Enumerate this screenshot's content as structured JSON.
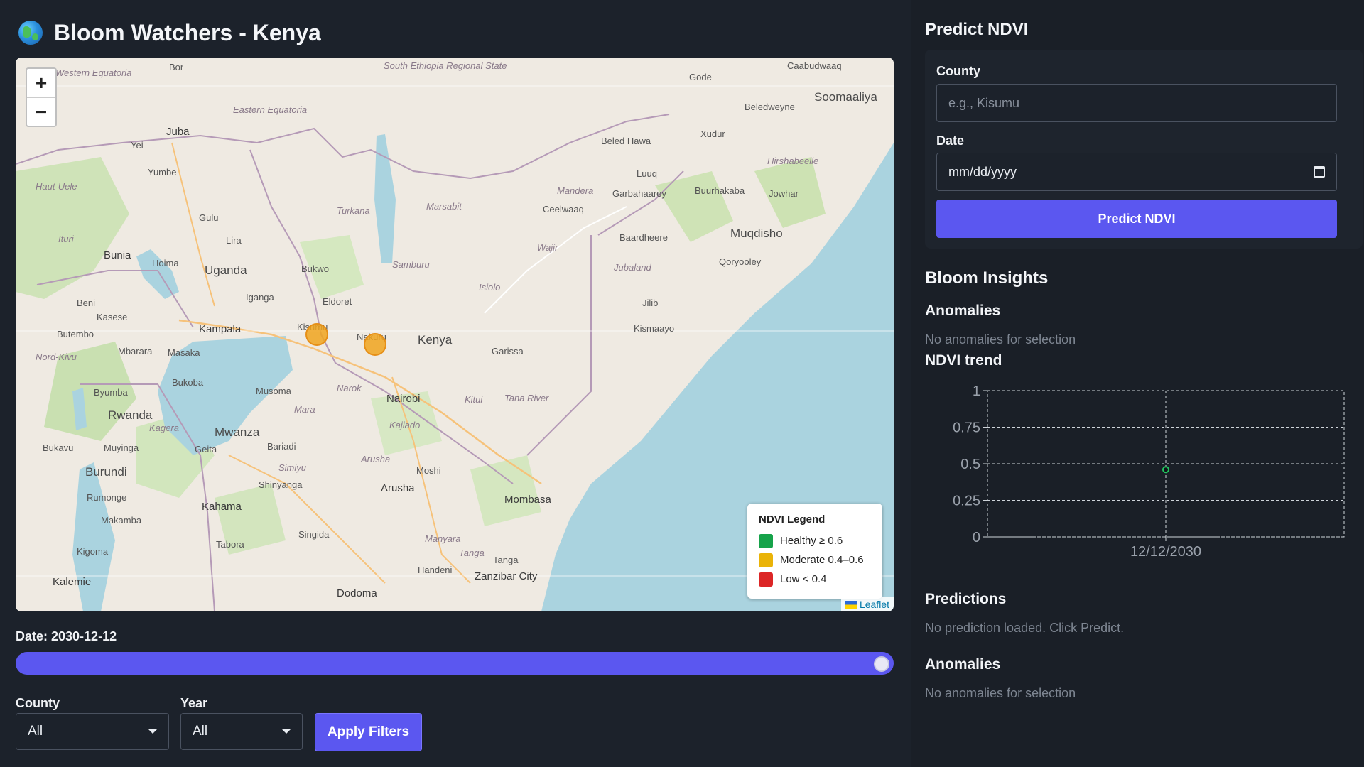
{
  "app": {
    "title": "Bloom Watchers - Kenya"
  },
  "map": {
    "labels": [
      {
        "text": "Bor"
      },
      {
        "text": "Juba"
      },
      {
        "text": "Yei"
      },
      {
        "text": "Yumbe"
      },
      {
        "text": "Gulu"
      },
      {
        "text": "Lira"
      },
      {
        "text": "Bunia"
      },
      {
        "text": "Hoima"
      },
      {
        "text": "Uganda"
      },
      {
        "text": "Beni"
      },
      {
        "text": "Kasese"
      },
      {
        "text": "Kampala"
      },
      {
        "text": "Butembo"
      },
      {
        "text": "Mbarara"
      },
      {
        "text": "Masaka"
      },
      {
        "text": "Bukoba"
      },
      {
        "text": "Byumba"
      },
      {
        "text": "Rwanda"
      },
      {
        "text": "Bukavu"
      },
      {
        "text": "Muyinga"
      },
      {
        "text": "Burundi"
      },
      {
        "text": "Rumonge"
      },
      {
        "text": "Makamba"
      },
      {
        "text": "Kigoma"
      },
      {
        "text": "Kalemie"
      },
      {
        "text": "Mwanza"
      },
      {
        "text": "Geita"
      },
      {
        "text": "Musoma"
      },
      {
        "text": "Bariadi"
      },
      {
        "text": "Shinyanga"
      },
      {
        "text": "Kahama"
      },
      {
        "text": "Tabora"
      },
      {
        "text": "Singida"
      },
      {
        "text": "Dodoma"
      },
      {
        "text": "Handeni"
      },
      {
        "text": "Tanga"
      },
      {
        "text": "Zanzibar City"
      },
      {
        "text": "Mombasa"
      },
      {
        "text": "Moshi"
      },
      {
        "text": "Arusha"
      },
      {
        "text": "Nairobi"
      },
      {
        "text": "Kenya"
      },
      {
        "text": "Eldoret"
      },
      {
        "text": "Bukwo"
      },
      {
        "text": "Iganga"
      },
      {
        "text": "Kisumu"
      },
      {
        "text": "Nakuru"
      },
      {
        "text": "Garissa"
      },
      {
        "text": "Kismaayo"
      },
      {
        "text": "Jilib"
      },
      {
        "text": "Qoryooley"
      },
      {
        "text": "Muqdisho"
      },
      {
        "text": "Baardheere"
      },
      {
        "text": "Buurhakaba"
      },
      {
        "text": "Garbahaarey"
      },
      {
        "text": "Luuq"
      },
      {
        "text": "Beled Hawa"
      },
      {
        "text": "Ceelwaaq"
      },
      {
        "text": "Xudur"
      },
      {
        "text": "Jowhar"
      },
      {
        "text": "Beledweyne"
      },
      {
        "text": "Gode"
      },
      {
        "text": "Caabudwaaq"
      },
      {
        "text": "Soomaaliya"
      },
      {
        "text": "Hirshabeelle"
      },
      {
        "text": "Mandera"
      },
      {
        "text": "Marsabit"
      },
      {
        "text": "Turkana"
      },
      {
        "text": "Samburu"
      },
      {
        "text": "Isiolo"
      },
      {
        "text": "Wajir"
      },
      {
        "text": "Jubaland"
      },
      {
        "text": "Kitui"
      },
      {
        "text": "Tana River"
      },
      {
        "text": "Kajiado"
      },
      {
        "text": "Narok"
      },
      {
        "text": "Mara"
      },
      {
        "text": "Simiyu"
      },
      {
        "text": "Kagera"
      },
      {
        "text": "Arusha"
      },
      {
        "text": "Manyara"
      },
      {
        "text": "Tanga"
      },
      {
        "text": "Ituri"
      },
      {
        "text": "Nord-Kivu"
      },
      {
        "text": "Haut-Uele"
      },
      {
        "text": "Eastern Equatoria"
      },
      {
        "text": "Western Equatoria"
      },
      {
        "text": "South Ethiopia Regional State"
      }
    ],
    "zoom_in": "+",
    "zoom_out": "−",
    "attribution": "Leaflet",
    "markers": [
      "Kisumu",
      "Nakuru"
    ]
  },
  "legend": {
    "title": "NDVI Legend",
    "items": [
      {
        "label": "Healthy ≥ 0.6",
        "color": "#16a34a"
      },
      {
        "label": "Moderate 0.4–0.6",
        "color": "#eab308"
      },
      {
        "label": "Low < 0.4",
        "color": "#dc2626"
      }
    ]
  },
  "timeline": {
    "date_label": "Date: 2030-12-12",
    "position": 1.0
  },
  "filters": {
    "county_label": "County",
    "county_value": "All",
    "year_label": "Year",
    "year_value": "All",
    "apply_label": "Apply Filters"
  },
  "predict": {
    "heading": "Predict NDVI",
    "county_label": "County",
    "county_placeholder": "e.g., Kisumu",
    "date_label": "Date",
    "date_placeholder": "mm/dd/yyyy",
    "button_label": "Predict NDVI"
  },
  "insights": {
    "heading": "Bloom Insights",
    "anomalies_heading": "Anomalies",
    "anomalies_text": "No anomalies for selection",
    "trend_heading": "NDVI trend",
    "predictions_heading": "Predictions",
    "predictions_text": "No prediction loaded. Click Predict.",
    "anomalies2_heading": "Anomalies",
    "anomalies2_text": "No anomalies for selection"
  },
  "chart_data": {
    "type": "line",
    "x": [
      "12/12/2030"
    ],
    "series": [
      {
        "values": [
          0.46
        ],
        "color": "#22c55e"
      }
    ],
    "ylim": [
      0,
      1
    ],
    "yticks": [
      "0",
      "0.25",
      "0.5",
      "0.75",
      "1"
    ],
    "grid": true
  },
  "colors": {
    "accent": "#5b57f0",
    "marker": "#f0a51e"
  }
}
